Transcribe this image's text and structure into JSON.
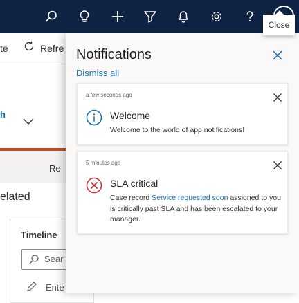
{
  "colors": {
    "nav_bg": "#0f2445",
    "accent": "#0f6cbd",
    "info": "#0f6cbd",
    "critical": "#c4262e"
  },
  "topbar": {
    "icons": [
      "search-icon",
      "lightbulb-icon",
      "add-icon",
      "filter-icon",
      "bell-icon",
      "settings-icon",
      "help-icon",
      "avatar"
    ]
  },
  "background": {
    "cmd_fragment_1": "te",
    "cmd_fragment_2": "Refre",
    "blue_fragment": "h",
    "tab_fragment": "Re",
    "related_fragment": "elated",
    "timeline_label": "Timeline",
    "search_fragment": "Sear",
    "enter_fragment": "Ente"
  },
  "panel": {
    "title": "Notifications",
    "dismiss_all": "Dismiss all",
    "close_tooltip": "Close"
  },
  "notifications": [
    {
      "time": "a few seconds ago",
      "icon": "info-icon",
      "title": "Welcome",
      "body": "Welcome to the world of app notifications!"
    },
    {
      "time": "5 minutes ago",
      "icon": "error-icon",
      "title": "SLA critical",
      "body_prefix": "Case record ",
      "link_text": "Service requested soon",
      "body_suffix": " assigned to you is critically past SLA and has been escalated to your manager."
    }
  ]
}
